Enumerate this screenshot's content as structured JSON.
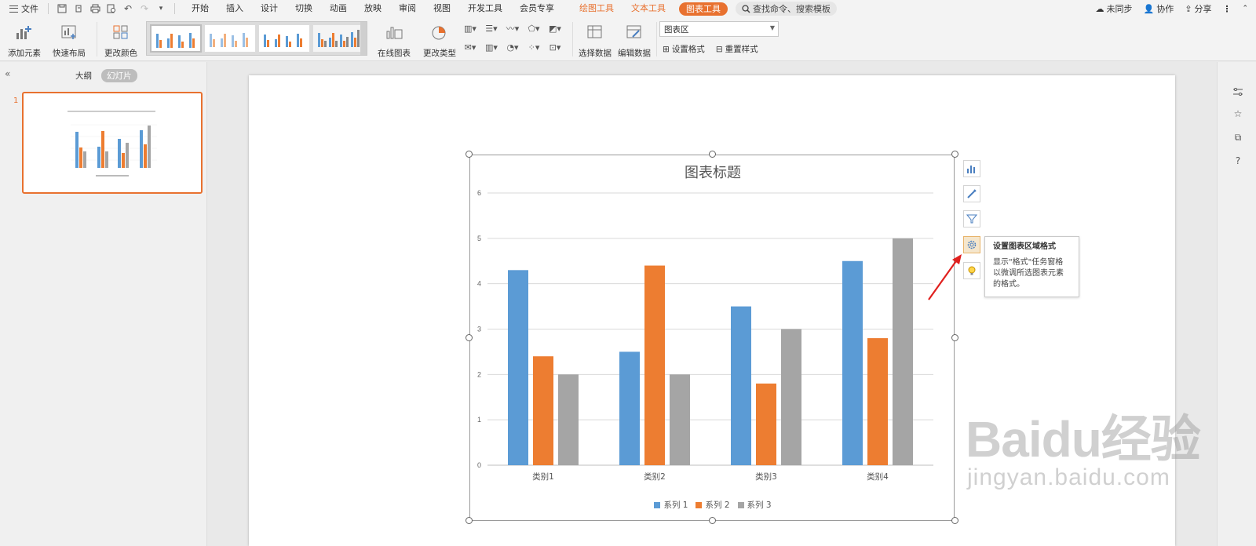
{
  "menubar": {
    "file_label": "文件",
    "tabs": [
      "开始",
      "插入",
      "设计",
      "切换",
      "动画",
      "放映",
      "审阅",
      "视图",
      "开发工具",
      "会员专享"
    ],
    "context_tabs": [
      "绘图工具",
      "文本工具"
    ],
    "active_tab": "图表工具",
    "search_placeholder": "查找命令、搜索模板",
    "sync_label": "未同步",
    "collab_label": "协作",
    "share_label": "分享"
  },
  "ribbon": {
    "add_element": "添加元素",
    "quick_layout": "快速布局",
    "change_color": "更改颜色",
    "online_chart": "在线图表",
    "change_type": "更改类型",
    "select_data": "选择数据",
    "edit_data": "编辑数据",
    "element_selector": "图表区",
    "set_format": "设置格式",
    "reset_style": "重置样式"
  },
  "left_pane": {
    "tab_outline": "大纲",
    "tab_slides": "幻灯片",
    "slide_number": "1"
  },
  "chart_data": {
    "type": "bar",
    "title": "图表标题",
    "categories": [
      "类别1",
      "类别2",
      "类别3",
      "类别4"
    ],
    "series": [
      {
        "name": "系列 1",
        "values": [
          4.3,
          2.5,
          3.5,
          4.5
        ],
        "color": "#5b9bd5"
      },
      {
        "name": "系列 2",
        "values": [
          2.4,
          4.4,
          1.8,
          2.8
        ],
        "color": "#ed7d31"
      },
      {
        "name": "系列 3",
        "values": [
          2,
          2,
          3,
          5
        ],
        "color": "#a5a5a5"
      }
    ],
    "ylim": [
      0,
      6
    ],
    "yticks": [
      "0",
      "1",
      "2",
      "3",
      "4",
      "5",
      "6"
    ],
    "grid": true,
    "legend_position": "bottom"
  },
  "tooltip": {
    "title": "设置图表区域格式",
    "body": "显示\"格式\"任务窗格以微调所选图表元素的格式。"
  },
  "watermark": {
    "main": "Baidu经验",
    "sub": "jingyan.baidu.com"
  }
}
